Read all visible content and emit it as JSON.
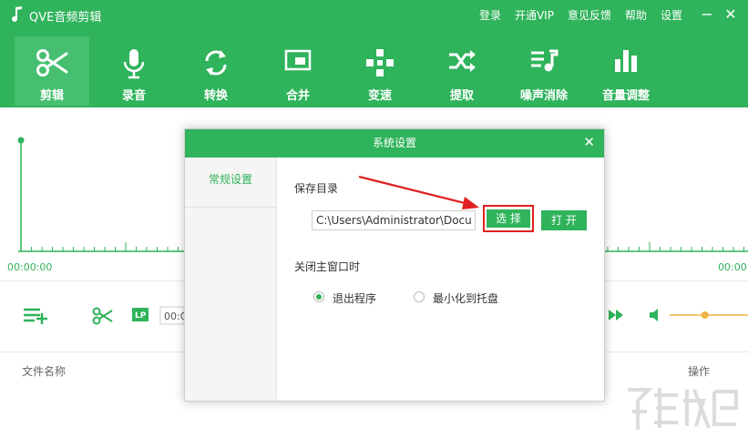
{
  "app": {
    "title": "QVE音频剪辑",
    "accent_color": "#2fb35b",
    "window_controls": [
      "−",
      "✕"
    ]
  },
  "menu": [
    {
      "label": "登录"
    },
    {
      "label": "开通VIP"
    },
    {
      "label": "意见反馈"
    },
    {
      "label": "帮助"
    },
    {
      "label": "设置"
    }
  ],
  "toolbar": [
    {
      "label": "剪辑",
      "icon": "scissors-icon",
      "active": true
    },
    {
      "label": "录音",
      "icon": "microphone-icon"
    },
    {
      "label": "转换",
      "icon": "convert-icon"
    },
    {
      "label": "合并",
      "icon": "merge-icon"
    },
    {
      "label": "变速",
      "icon": "speed-icon"
    },
    {
      "label": "提取",
      "icon": "extract-icon"
    },
    {
      "label": "噪声消除",
      "icon": "noise-removal-icon"
    },
    {
      "label": "音量调整",
      "icon": "volume-adjust-icon"
    }
  ],
  "timeline": {
    "start_time": "00:00:00",
    "end_time": "00:00"
  },
  "controls": {
    "lp_label": "LP",
    "time_field": "00:0",
    "volume_level": 0.45
  },
  "file_list": {
    "col_file": "文件名称",
    "col_op": "操作"
  },
  "dialog": {
    "title": "系统设置",
    "close": "✕",
    "side_item": "常规设置",
    "save_dir_label": "保存目录",
    "save_path": "C:\\Users\\Administrator\\Documents",
    "choose_button": "选 择",
    "open_button": "打 开",
    "close_main_label": "关闭主窗口时",
    "radio_options": [
      {
        "label": "退出程序",
        "checked": true
      },
      {
        "label": "最小化到托盘",
        "checked": false
      }
    ]
  }
}
